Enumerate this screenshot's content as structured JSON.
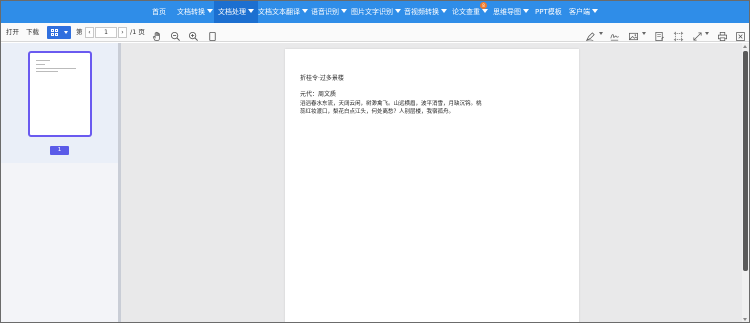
{
  "nav": {
    "items": [
      {
        "label": "首页",
        "caret": false
      },
      {
        "label": "文档转换",
        "caret": true
      },
      {
        "label": "文档处理",
        "caret": true,
        "active": true
      },
      {
        "label": "文档文本翻译",
        "caret": true
      },
      {
        "label": "语音识别",
        "caret": true
      },
      {
        "label": "图片文字识别",
        "caret": true
      },
      {
        "label": "音视频转换",
        "caret": true
      },
      {
        "label": "论文查重",
        "caret": true,
        "badge": "8"
      },
      {
        "label": "思维导图",
        "caret": true
      },
      {
        "label": "PPT模板",
        "caret": false
      },
      {
        "label": "客户端",
        "caret": true
      }
    ],
    "color": "#2f8de8",
    "active_color": "#1c6fd0"
  },
  "toolbar": {
    "open_label": "打开",
    "download_label": "下载",
    "page_prefix": "第",
    "current_page": "1",
    "total_pages": "/1 页"
  },
  "sidebar": {
    "page_button": "1",
    "accent": "#5b5be8"
  },
  "document": {
    "title": "折桂令·过多景楼",
    "author": "元代：周文质",
    "body": "滔滔春水东流，天阔云闲，树渺禽飞。山远横眉，波平消雪，月缺沉钩。桃蕊红妆渡口，梨花白点江头，何处离愁？人别层楼，我宿孤舟。"
  }
}
